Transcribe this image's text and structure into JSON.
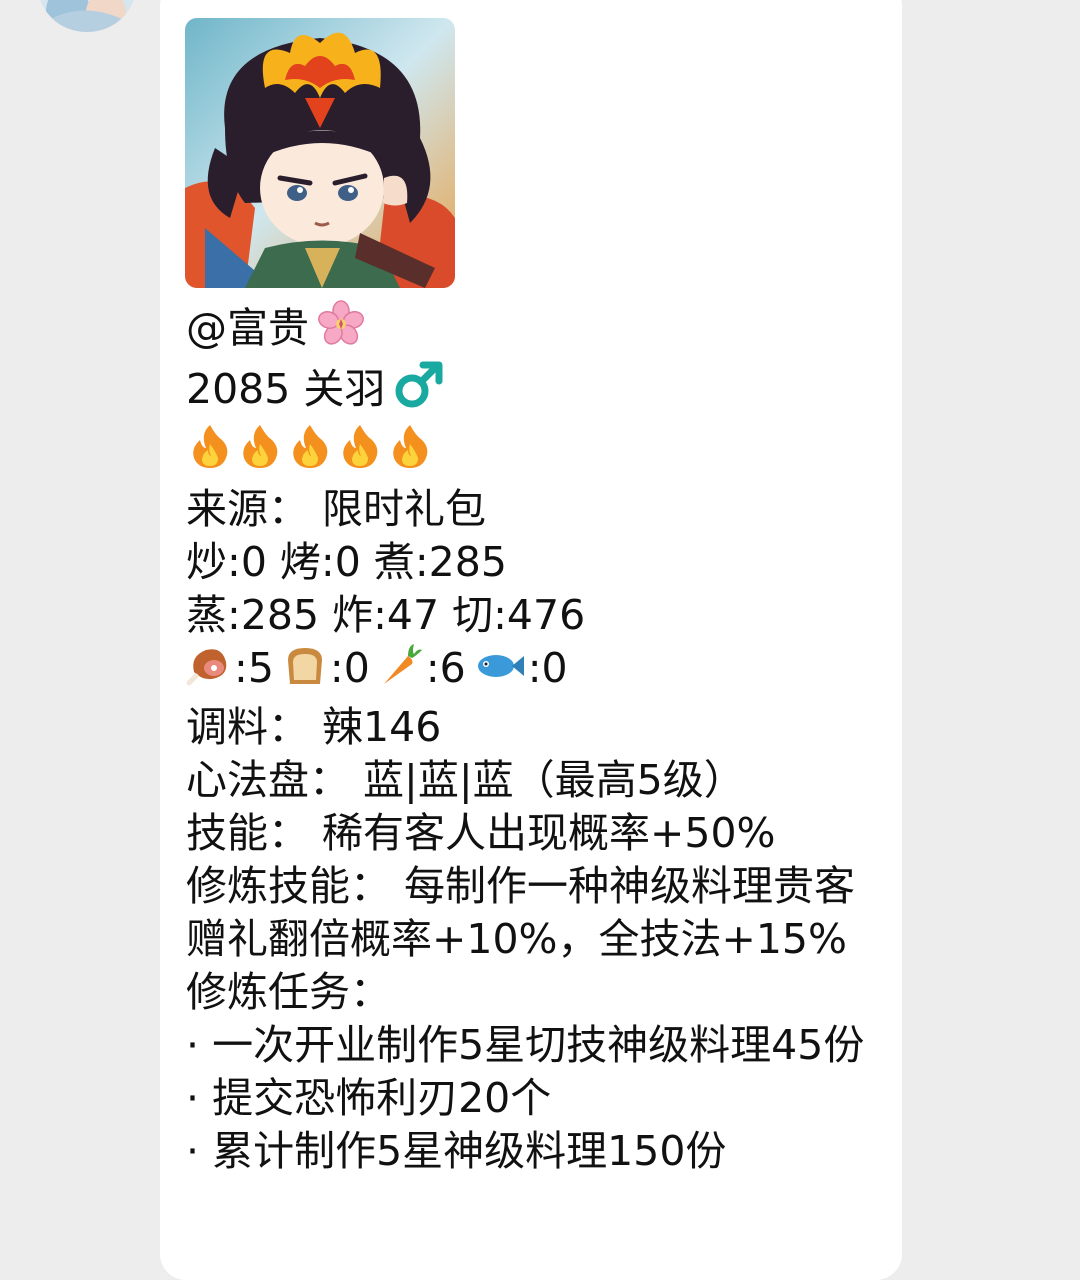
{
  "message": {
    "mention": "@富贵",
    "name_line": "2085 关羽",
    "source": "来源：  限时礼包",
    "skills_line1": "炒:0 烤:0 煮:285",
    "skills_line2": "蒸:285 炸:47 切:476",
    "ingredients": [
      {
        "icon": "meat-icon",
        "value": ":5"
      },
      {
        "icon": "bread-icon",
        "value": ":0"
      },
      {
        "icon": "carrot-icon",
        "value": ":6"
      },
      {
        "icon": "fish-icon",
        "value": ":0"
      }
    ],
    "seasoning": "调料：  辣146",
    "heart_plate": "心法盘：  蓝|蓝|蓝（最高5级）",
    "skill": "技能：  稀有客人出现概率+50%",
    "cultivation_skill": "修炼技能：  每制作一种神级料理贵客赠礼翻倍概率+10%，全技法+15%",
    "tasks_title": "修炼任务：",
    "tasks": [
      "· 一次开业制作5星切技神级料理45份",
      "· 提交恐怖利刃20个",
      "· 累计制作5星神级料理150份"
    ],
    "fire_count": 5
  },
  "icons": {
    "flower": "cherry-blossom-icon",
    "gender": "male-sign-icon",
    "fire": "fire-icon"
  },
  "colors": {
    "background": "#ededed",
    "bubble": "#ffffff",
    "male_sign": "#1aa9a0"
  }
}
